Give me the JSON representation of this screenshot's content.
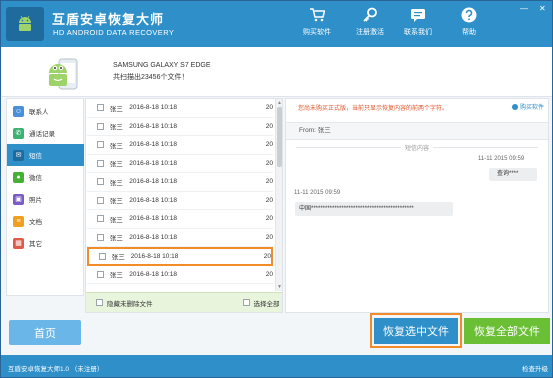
{
  "app": {
    "title": "互盾安卓恢复大师",
    "subtitle": "HD ANDROID DATA RECOVERY"
  },
  "topnav": [
    {
      "label": "购买软件",
      "icon": "cart-icon"
    },
    {
      "label": "注册激活",
      "icon": "key-icon"
    },
    {
      "label": "联系我们",
      "icon": "chat-icon"
    },
    {
      "label": "帮助",
      "icon": "help-icon"
    }
  ],
  "window_controls": {
    "minimize": "—",
    "close": "✕"
  },
  "device": {
    "name": "SAMSUNG GALAXY S7 EDGE",
    "count": "共扫描出23456个文件！"
  },
  "categories": [
    {
      "label": "联系人",
      "icon": "contacts-icon",
      "color": "#4a90d9"
    },
    {
      "label": "通话记录",
      "icon": "phone-icon",
      "color": "#3cb371"
    },
    {
      "label": "短信",
      "icon": "sms-icon",
      "color": "#2e8fc9",
      "active": true
    },
    {
      "label": "微信",
      "icon": "wechat-icon",
      "color": "#45b035"
    },
    {
      "label": "照片",
      "icon": "photo-icon",
      "color": "#7b5cc4"
    },
    {
      "label": "文档",
      "icon": "document-icon",
      "color": "#f0a020"
    },
    {
      "label": "其它",
      "icon": "other-icon",
      "color": "#e05a4a"
    }
  ],
  "list": {
    "rows": [
      {
        "name": "张三",
        "date": "2016-8-18 10:18",
        "count": "20"
      },
      {
        "name": "张三",
        "date": "2016-8-18 10:18",
        "count": "20"
      },
      {
        "name": "张三",
        "date": "2016-8-18 10:18",
        "count": "20"
      },
      {
        "name": "张三",
        "date": "2016-8-18 10:18",
        "count": "20"
      },
      {
        "name": "张三",
        "date": "2016-8-18 10:18",
        "count": "20"
      },
      {
        "name": "张三",
        "date": "2016-8-18 10:18",
        "count": "20"
      },
      {
        "name": "张三",
        "date": "2016-8-18 10:18",
        "count": "20"
      },
      {
        "name": "张三",
        "date": "2016-8-18 10:18",
        "count": "20"
      },
      {
        "name": "张三",
        "date": "2016-8-18 10:18",
        "count": "20",
        "selected": true
      },
      {
        "name": "张三",
        "date": "2016-8-18 10:18",
        "count": "20"
      }
    ],
    "hide_undeleted": "隐藏未删除文件",
    "select_all": "选择全部"
  },
  "detail": {
    "notice": "您尚未购买正式版，当前只显示恢复内容的前两个字符。",
    "buy_link": "购买软件",
    "from": "From: 张三",
    "section_label": "短信内容",
    "msg1_time": "11-11 2015 09:59",
    "msg1_text": "查询****",
    "msg2_time": "11-11 2015 09:59",
    "msg2_text": "中国********************************************"
  },
  "buttons": {
    "home": "首页",
    "recover_selected": "恢复选中文件",
    "recover_all": "恢复全部文件"
  },
  "status": {
    "version": "互盾安卓恢复大师1.0 （未注册）",
    "check_update": "检查升级"
  },
  "colors": {
    "brand": "#2e8fc9",
    "green": "#6abf35",
    "highlight": "#f28c28"
  }
}
